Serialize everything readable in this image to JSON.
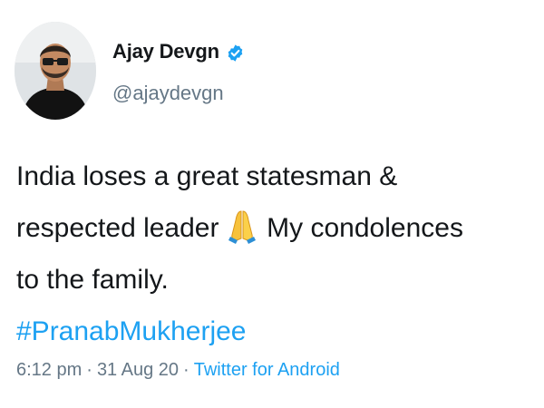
{
  "author": {
    "display_name": "Ajay Devgn",
    "handle": "@ajaydevgn",
    "verified": true,
    "avatar_icon": "profile-photo"
  },
  "tweet": {
    "line1": "India loses a great statesman &",
    "line2_before_emoji": "respected leader",
    "emoji": "folded-hands-emoji",
    "line2_after_emoji": "My condolences",
    "line3": "to the family.",
    "hashtag": "#PranabMukherjee"
  },
  "meta": {
    "time": "6:12 pm",
    "separator": "·",
    "date": "31 Aug 20",
    "source": "Twitter for Android"
  },
  "colors": {
    "link": "#1da1f2",
    "secondary_text": "#657786",
    "primary_text": "#14171a",
    "verified_badge": "#1da1f2"
  }
}
